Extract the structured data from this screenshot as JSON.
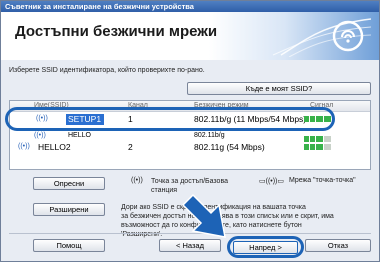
{
  "window": {
    "title": "Съветник за инсталиране на безжични устройства"
  },
  "header": {
    "title": "Достъпни безжични мрежи"
  },
  "instruction": "Изберете SSID идентификатора, който проверихте по-рано.",
  "where_ssid_button": "Къде е моят SSID?",
  "list": {
    "columns": [
      "Име(SSID)",
      "Канал",
      "Безжичен режим",
      "Сигнал"
    ],
    "rows": [
      {
        "ssid": "SETUP1",
        "channel": "1",
        "mode": "802.11b/g (11 Mbps/54 Mbps)",
        "signal": 4,
        "selected": true
      },
      {
        "ssid": "HELLO",
        "channel": "",
        "mode": "802.11b/g",
        "signal": 3,
        "selected": false
      },
      {
        "ssid": "HELLO2",
        "channel": "2",
        "mode": "802.11g (54 Mbps)",
        "signal": 3,
        "selected": false
      }
    ]
  },
  "legend": {
    "access_point": "Точка за достъп/Базова станция",
    "adhoc": "Мрежа \"точка-точка\""
  },
  "buttons": {
    "refresh": "Опресни",
    "advanced": "Разширени",
    "help": "Помощ",
    "back": "< Назад",
    "next": "Напред >",
    "cancel": "Отказ"
  },
  "note": {
    "line1": "Дори ако SSID е скрит (Идентификация на вашата точка",
    "line2": "за безжичен достъп не се появява в този списък или е скрит, има",
    "line3": "възможност да го конфигурирате, като натиснете бутон",
    "line4": "'Разширени'."
  },
  "colors": {
    "accent": "#1d63b6",
    "signal": "#38b24a",
    "selection": "#2a6fd1"
  },
  "icons": {
    "logo": "wireless-logo-icon",
    "network": "network-icon",
    "arrow": "pointer-arrow-icon"
  }
}
